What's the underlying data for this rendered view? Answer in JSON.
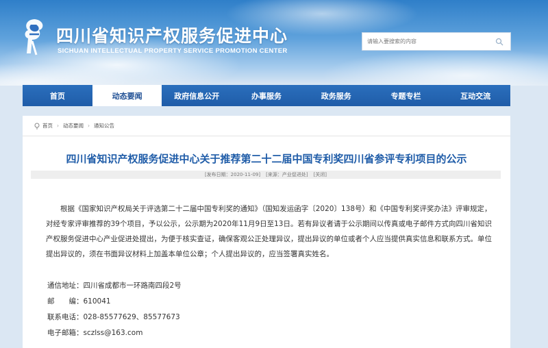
{
  "header": {
    "site_title": "四川省知识产权服务促进中心",
    "site_subtitle": "SICHUAN INTELLECTUAL PROPERTY SERVICE PROMOTION CENTER",
    "search_placeholder": "请输入要搜索的内容"
  },
  "nav": {
    "items": [
      "首页",
      "动态要闻",
      "政府信息公开",
      "办事服务",
      "政务服务",
      "专题专栏",
      "互动交流"
    ],
    "active_index": 1
  },
  "breadcrumb": [
    "首页",
    "动态要闻",
    "通知公告"
  ],
  "article": {
    "title": "四川省知识产权服务促进中心关于推荐第二十二届中国专利奖四川省参评专利项目的公示",
    "meta": {
      "publish_date": "[发布日期：2020-11-09]",
      "source": "[来源：产业促进处]",
      "close": "[关闭]"
    },
    "body": "根据《国家知识产权局关于评选第二十二届中国专利奖的通知》（国知发运函字〔2020〕138号）和《中国专利奖评奖办法》评审规定，对经专家评审推荐的39个项目，予以公示，公示期为2020年11月9日至13日。若有异议者请于公示期间以传真或电子邮件方式向四川省知识产权服务促进中心产业促进处提出，为便于核实查证，确保客观公正处理异议，提出异议的单位或者个人应当提供真实信息和联系方式。单位提出异议的，须在书面异议材料上加盖本单位公章；个人提出异议的，应当签署真实姓名。",
    "contact": {
      "address": "通信地址：四川省成都市一环路南四段2号",
      "postcode": "邮　　编：610041",
      "phone": "联系电话：028-85577629、85577673",
      "email": "电子邮箱：sczlss@163.com"
    }
  },
  "colors": {
    "nav_bg": "#1f5ca8",
    "title_blue": "#1f5ca8",
    "active_nav_bg": "#ffffff"
  },
  "icons": {
    "logo": "sichuan-ip-logo",
    "search": "search-icon",
    "home": "home-icon"
  }
}
